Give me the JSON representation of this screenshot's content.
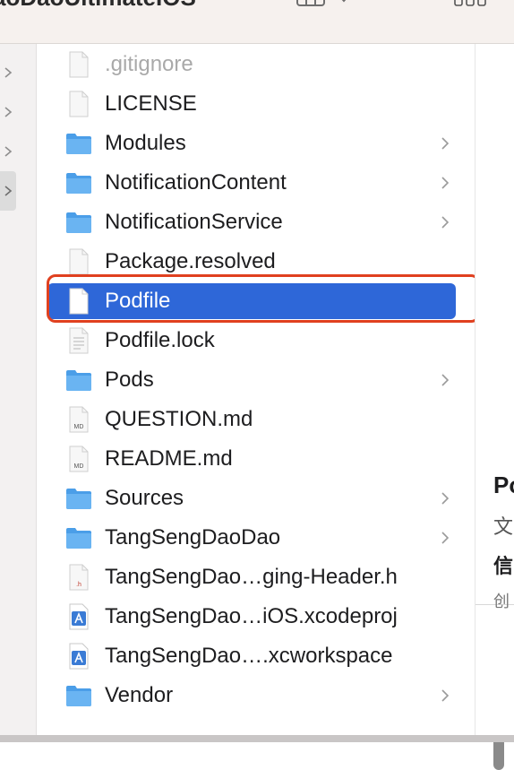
{
  "window": {
    "title": "aoDaoUltimateIOS"
  },
  "files": [
    {
      "name": ".gitignore",
      "kind": "document",
      "faded": true,
      "folder": false
    },
    {
      "name": "LICENSE",
      "kind": "document",
      "faded": false,
      "folder": false
    },
    {
      "name": "Modules",
      "kind": "folder",
      "faded": false,
      "folder": true
    },
    {
      "name": "NotificationContent",
      "kind": "folder",
      "faded": false,
      "folder": true
    },
    {
      "name": "NotificationService",
      "kind": "folder",
      "faded": false,
      "folder": true
    },
    {
      "name": "Package.resolved",
      "kind": "document",
      "faded": false,
      "folder": false
    },
    {
      "name": "Podfile",
      "kind": "document",
      "faded": false,
      "folder": false,
      "selected": true
    },
    {
      "name": "Podfile.lock",
      "kind": "text",
      "faded": false,
      "folder": false
    },
    {
      "name": "Pods",
      "kind": "folder",
      "faded": false,
      "folder": true
    },
    {
      "name": "QUESTION.md",
      "kind": "markdown",
      "faded": false,
      "folder": false,
      "badge": "MD"
    },
    {
      "name": "README.md",
      "kind": "markdown",
      "faded": false,
      "folder": false,
      "badge": "MD"
    },
    {
      "name": "Sources",
      "kind": "folder",
      "faded": false,
      "folder": true
    },
    {
      "name": "TangSengDaoDao",
      "kind": "folder",
      "faded": false,
      "folder": true
    },
    {
      "name": "TangSengDao…ging-Header.h",
      "kind": "header",
      "faded": false,
      "folder": false,
      "badge": ".h"
    },
    {
      "name": "TangSengDao…iOS.xcodeproj",
      "kind": "xcodeproj",
      "faded": false,
      "folder": false
    },
    {
      "name": "TangSengDao….xcworkspace",
      "kind": "xcworkspace",
      "faded": false,
      "folder": false
    },
    {
      "name": "Vendor",
      "kind": "folder",
      "faded": false,
      "folder": true
    }
  ],
  "preview": {
    "title_fragment": "Po",
    "kind_fragment": "文",
    "info_fragment": "信",
    "created_fragment": "创"
  },
  "colors": {
    "selection": "#2e67d8",
    "highlight_outline": "#e0401f",
    "folder": "#5aa9ee"
  }
}
